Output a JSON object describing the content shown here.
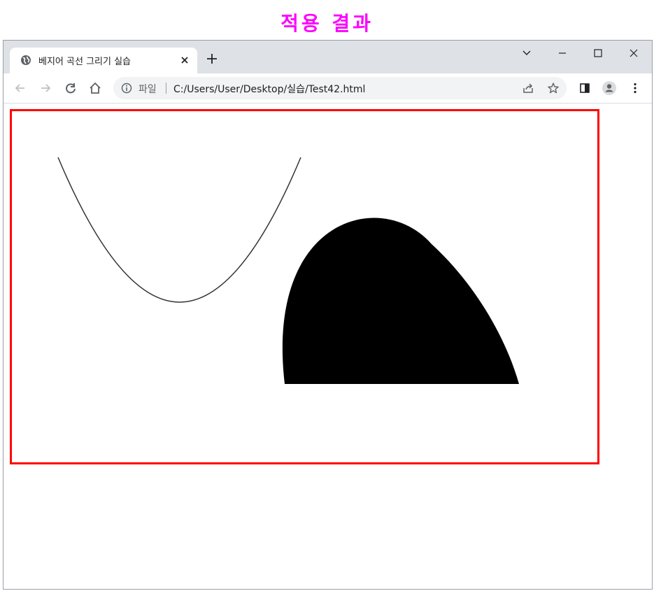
{
  "caption": "적용 결과",
  "browser": {
    "tab": {
      "title": "베지어 곡선 그리기 실습",
      "favicon": "globe-icon"
    },
    "address": {
      "scheme_label": "파일",
      "url": "C:/Users/User/Desktop/실습/Test42.html"
    }
  },
  "canvas": {
    "border_color": "#ff0000",
    "stroke_color": "#333333",
    "fill_color": "#000000"
  }
}
